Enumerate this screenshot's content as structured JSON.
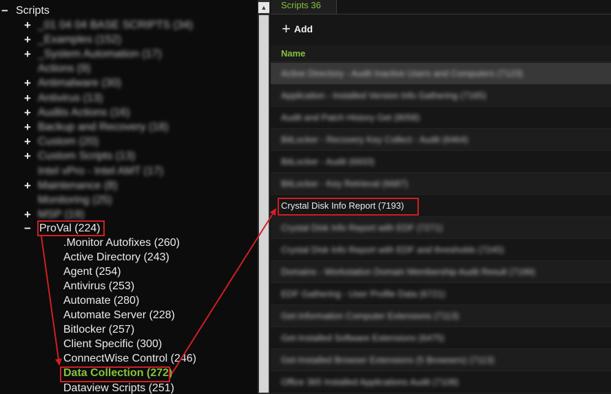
{
  "tree": {
    "root": {
      "toggle": "−",
      "label": "Scripts"
    },
    "blurred_items": [
      {
        "toggle": "+",
        "label": "_01 04 04 BASE SCRIPTS (34)"
      },
      {
        "toggle": "+",
        "label": "_Examples (152)"
      },
      {
        "toggle": "+",
        "label": "_System Automation (17)"
      },
      {
        "toggle": "",
        "label": "Actions (9)"
      },
      {
        "toggle": "+",
        "label": "Antimalware (30)"
      },
      {
        "toggle": "+",
        "label": "Antivirus (13)"
      },
      {
        "toggle": "+",
        "label": "Audits Actions (16)"
      },
      {
        "toggle": "+",
        "label": "Backup and Recovery (18)"
      },
      {
        "toggle": "+",
        "label": "Custom (20)"
      },
      {
        "toggle": "+",
        "label": "Custom Scripts (13)"
      },
      {
        "toggle": "",
        "label": "Intel vPro - Intel AMT (17)"
      },
      {
        "toggle": "+",
        "label": "Maintenance (8)"
      },
      {
        "toggle": "",
        "label": "Monitoring (25)"
      },
      {
        "toggle": "+",
        "label": "MSP (19)"
      }
    ],
    "proval": {
      "toggle": "−",
      "label": "ProVal (224)"
    },
    "children": [
      {
        "label": ".Monitor Autofixes (260)",
        "selected": false
      },
      {
        "label": "Active Directory (243)",
        "selected": false
      },
      {
        "label": "Agent (254)",
        "selected": false
      },
      {
        "label": "Antivirus (253)",
        "selected": false
      },
      {
        "label": "Automate (280)",
        "selected": false
      },
      {
        "label": "Automate Server (228)",
        "selected": false
      },
      {
        "label": "Bitlocker (257)",
        "selected": false
      },
      {
        "label": "Client Specific (300)",
        "selected": false
      },
      {
        "label": "ConnectWise Control (246)",
        "selected": false
      },
      {
        "label": "Data Collection (272)",
        "selected": true
      },
      {
        "label": "Dataview Scripts (251)",
        "selected": false
      }
    ]
  },
  "scrollbar": {
    "up_icon": "▲"
  },
  "panel": {
    "tab_label": "Scripts 36",
    "add_icon": "+",
    "add_label": "Add",
    "column_header": "Name",
    "rows": [
      {
        "label": "Active Directory - Audit Inactive Users and Computers (7123)",
        "blurred": true
      },
      {
        "label": "Application - Installed Version Info Gathering (7165)",
        "blurred": true
      },
      {
        "label": "Audit and Patch History Get (8058)",
        "blurred": true
      },
      {
        "label": "BitLocker - Recovery Key Collect - Audit (6464)",
        "blurred": true
      },
      {
        "label": "BitLocker - Audit (6933)",
        "blurred": true
      },
      {
        "label": "BitLocker - Key Retrieval (6687)",
        "blurred": true
      },
      {
        "label": "Crystal Disk Info Report (7193)",
        "blurred": false
      },
      {
        "label": "Crystal Disk Info Report with EDF (7271)",
        "blurred": true
      },
      {
        "label": "Crystal Disk Info Report with EDF and thresholds (7245)",
        "blurred": true
      },
      {
        "label": "Domains - Workstation Domain Membership Audit Result (7199)",
        "blurred": true
      },
      {
        "label": "EDF Gathering - User Profile Data (6721)",
        "blurred": true
      },
      {
        "label": "Get-Information Computer Extensions (7113)",
        "blurred": true
      },
      {
        "label": "Get-Installed Software Extensions (6475)",
        "blurred": true
      },
      {
        "label": "Get-Installed Browser Extensions (5 Browsers) (7113)",
        "blurred": true
      },
      {
        "label": "Office 365 Installed Applications Audit (7108)",
        "blurred": true
      }
    ]
  },
  "colors": {
    "accent_green": "#86c23d",
    "highlight_red": "#d21e24"
  }
}
